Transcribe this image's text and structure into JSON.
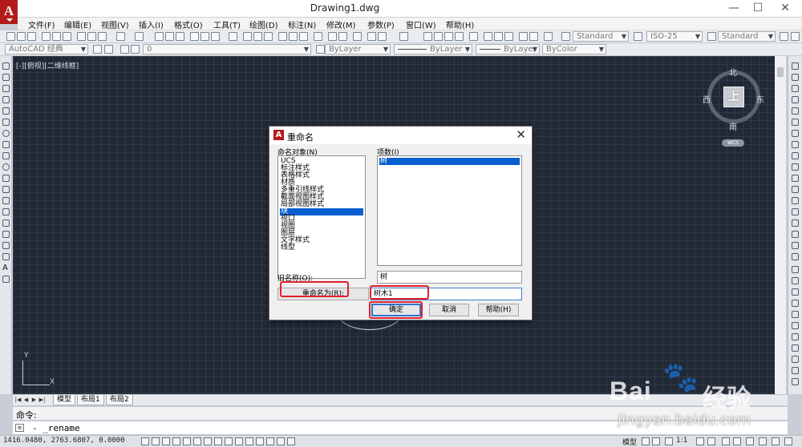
{
  "window": {
    "title": "Drawing1.dwg",
    "min": "—",
    "max": "☐",
    "close": "✕"
  },
  "menu": [
    "文件(F)",
    "编辑(E)",
    "视图(V)",
    "插入(I)",
    "格式(O)",
    "工具(T)",
    "绘图(D)",
    "标注(N)",
    "修改(M)",
    "参数(P)",
    "窗口(W)",
    "帮助(H)"
  ],
  "toolbar": {
    "text_style": "Standard",
    "dim_style": "ISO-25",
    "table_style": "Standard",
    "workspace": "AutoCAD 经典",
    "layer": "0",
    "color": "ByLayer",
    "linetype": "ByLayer",
    "lineweight": "ByLayer",
    "plot_style": "ByColor"
  },
  "viewport": {
    "label": "[-][俯视][二维线框]"
  },
  "viewcube": {
    "north": "北",
    "south": "南",
    "west": "西",
    "east": "东",
    "face": "上",
    "ucs": "WCS"
  },
  "ucs_icon": {
    "x": "X",
    "y": "Y"
  },
  "dialog": {
    "title": "重命名",
    "close": "✕",
    "objects_label": "命名对象(N)",
    "objects": [
      "UCS",
      "标注样式",
      "表格样式",
      "材质",
      "多重引线样式",
      "截面视图样式",
      "局部视图样式",
      "块",
      "视口",
      "视图",
      "图层",
      "文字样式",
      "线型"
    ],
    "selected_object": "块",
    "items_label": "项数(I)",
    "items": [
      "树"
    ],
    "selected_item": "树",
    "old_name_label": "旧名称(O):",
    "old_name_value": "树",
    "rename_to_label": "重命名为(R):",
    "rename_to_value": "树木1",
    "ok": "确定",
    "cancel": "取消",
    "help": "帮助(H)"
  },
  "layout_tabs": {
    "model": "模型",
    "layout1": "布局1",
    "layout2": "布局2"
  },
  "command": {
    "history": "命令:",
    "input": "- _rename"
  },
  "status": {
    "coords": "1416.0480,  2763.6807,  0.0000",
    "model": "模型",
    "scale": "1:1"
  },
  "watermark": {
    "brand": "Bai",
    "brand_cn": "经验",
    "url": "jingyan.baidu.com",
    "paw": "🐾"
  },
  "colors": {
    "canvas": "#222936",
    "selection": "#0a5fcf",
    "highlight": "#e3202a",
    "logo": "#b51a1a"
  }
}
